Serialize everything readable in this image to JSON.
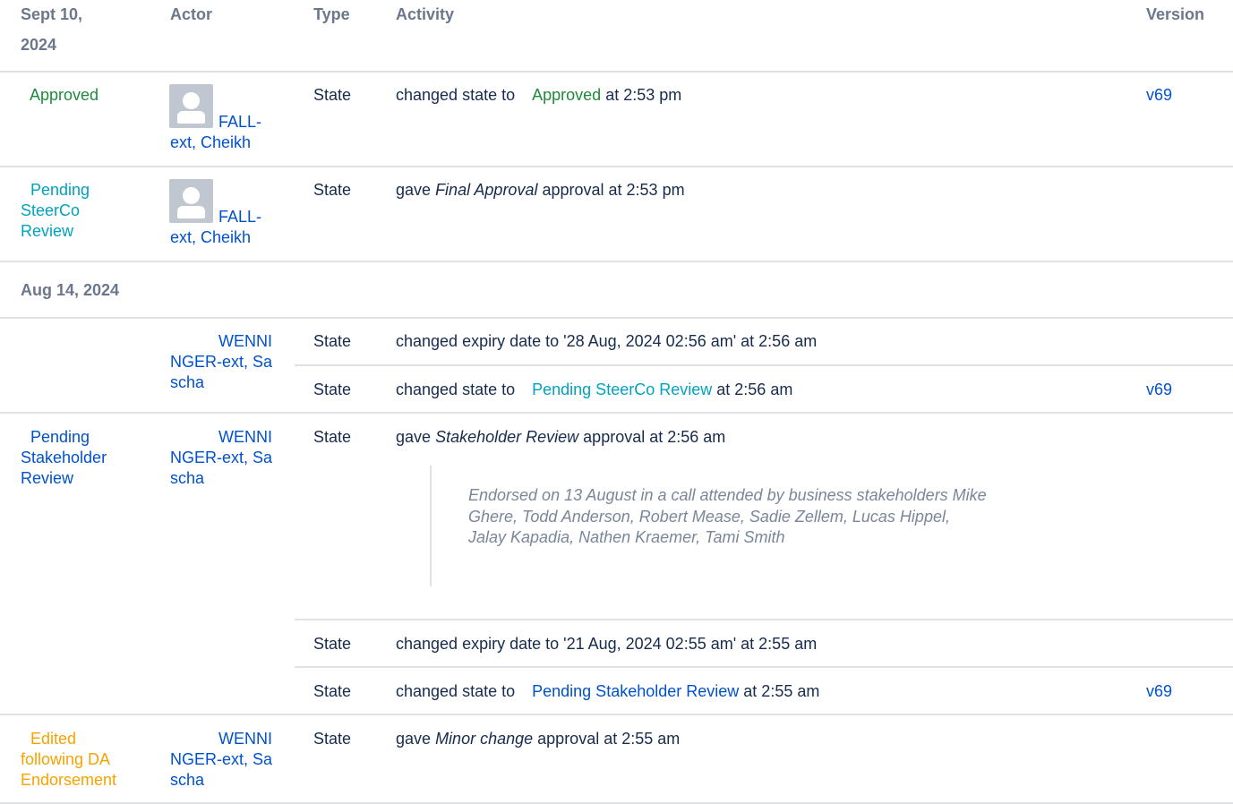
{
  "headers": {
    "date": "Sept 10, 2024",
    "actor": "Actor",
    "type": "Type",
    "activity": "Activity",
    "version": "Version"
  },
  "sept_group": {
    "rows": [
      {
        "state_label": "Approved",
        "actor": "FALL-ext, Cheikh",
        "type": "State",
        "activity_prefix": "changed state to",
        "activity_state": "Approved",
        "activity_suffix": "at 2:53 pm",
        "version": "v69"
      },
      {
        "state_label": "Pending SteerCo Review",
        "actor": "FALL-ext, Cheikh",
        "type": "State",
        "activity_prefix": "gave",
        "activity_em": "Final Approval",
        "activity_suffix": "approval at 2:53 pm"
      }
    ]
  },
  "aug_group": {
    "date": "Aug 14, 2024",
    "block1": {
      "actor": "WENNINGER-ext, Sascha",
      "rows": [
        {
          "type": "State",
          "activity": "changed expiry date to '28 Aug, 2024 02:56 am' at 2:56 am"
        },
        {
          "type": "State",
          "activity_prefix": "changed state to",
          "activity_state": "Pending SteerCo Review",
          "activity_suffix": "at 2:56 am",
          "version": "v69"
        }
      ]
    },
    "block2": {
      "state_label": "Pending Stakeholder Review",
      "actor": "WENNINGER-ext, Sascha",
      "rows": [
        {
          "type": "State",
          "activity_prefix": "gave",
          "activity_em": "Stakeholder Review",
          "activity_suffix": "approval at 2:56 am",
          "comment": "Endorsed on 13 August in a call attended by business stakeholders Mike Ghere, Todd Anderson, Robert Mease, Sadie Zellem, Lucas Hippel, Jalay Kapadia, Nathen Kraemer, Tami Smith"
        },
        {
          "type": "State",
          "activity": "changed expiry date to '21 Aug, 2024 02:55 am' at 2:55 am"
        },
        {
          "type": "State",
          "activity_prefix": "changed state to",
          "activity_state": "Pending Stakeholder Review",
          "activity_suffix": "at 2:55 am",
          "version": "v69"
        }
      ]
    },
    "block3": {
      "state_label": "Edited following DA Endorsement",
      "actor": "WENNINGER-ext, Sascha",
      "rows": [
        {
          "type": "State",
          "activity_prefix": "gave",
          "activity_em": "Minor change",
          "activity_suffix": "approval at 2:55 am"
        }
      ]
    }
  },
  "colors": {
    "approved": "#1f8a3b",
    "steerco": "#00a3bf",
    "pending": "#0052cc",
    "edited": "#f5a300",
    "link": "#0052cc",
    "header": "#6b778c",
    "divider": "#dfe1e6"
  },
  "icons": {
    "avatar": "default-user-avatar-icon"
  }
}
